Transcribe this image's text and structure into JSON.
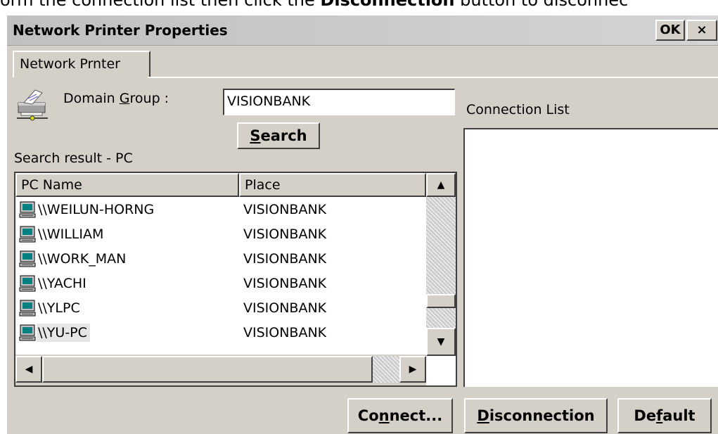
{
  "doc_text": {
    "before": "orm the connection list then click the ",
    "bold": "Disconnection",
    "after": " button to disconnec"
  },
  "window": {
    "title": "Network Printer Properties",
    "ok_label": "OK",
    "close_label": "×"
  },
  "tabs": [
    {
      "label": "Network Prnter",
      "active": true
    }
  ],
  "domain_group": {
    "label_pre": "Domain ",
    "label_accel": "G",
    "label_post": "roup :",
    "value": "VISIONBANK",
    "icon": "printer-icon"
  },
  "search_button": {
    "accel": "S",
    "rest": "earch"
  },
  "search_result_label": "Search result - PC",
  "connection_list_label": "Connection List",
  "results_table": {
    "columns": [
      "PC Name",
      "Place"
    ],
    "rows": [
      {
        "pc": "\\\\WEILUN-HORNG",
        "place": "VISIONBANK",
        "selected": false
      },
      {
        "pc": "\\\\WILLIAM",
        "place": "VISIONBANK",
        "selected": false
      },
      {
        "pc": "\\\\WORK_MAN",
        "place": "VISIONBANK",
        "selected": false
      },
      {
        "pc": "\\\\YACHI",
        "place": "VISIONBANK",
        "selected": false
      },
      {
        "pc": "\\\\YLPC",
        "place": "VISIONBANK",
        "selected": false
      },
      {
        "pc": "\\\\YU-PC",
        "place": "VISIONBANK",
        "selected": true
      }
    ],
    "row_icon": "computer-icon"
  },
  "buttons": {
    "connect": {
      "pre": "Co",
      "accel": "n",
      "post": "nect..."
    },
    "disconnection": {
      "pre": "",
      "accel": "D",
      "post": "isconnection"
    },
    "default": {
      "pre": "De",
      "accel": "f",
      "post": "ault"
    }
  }
}
